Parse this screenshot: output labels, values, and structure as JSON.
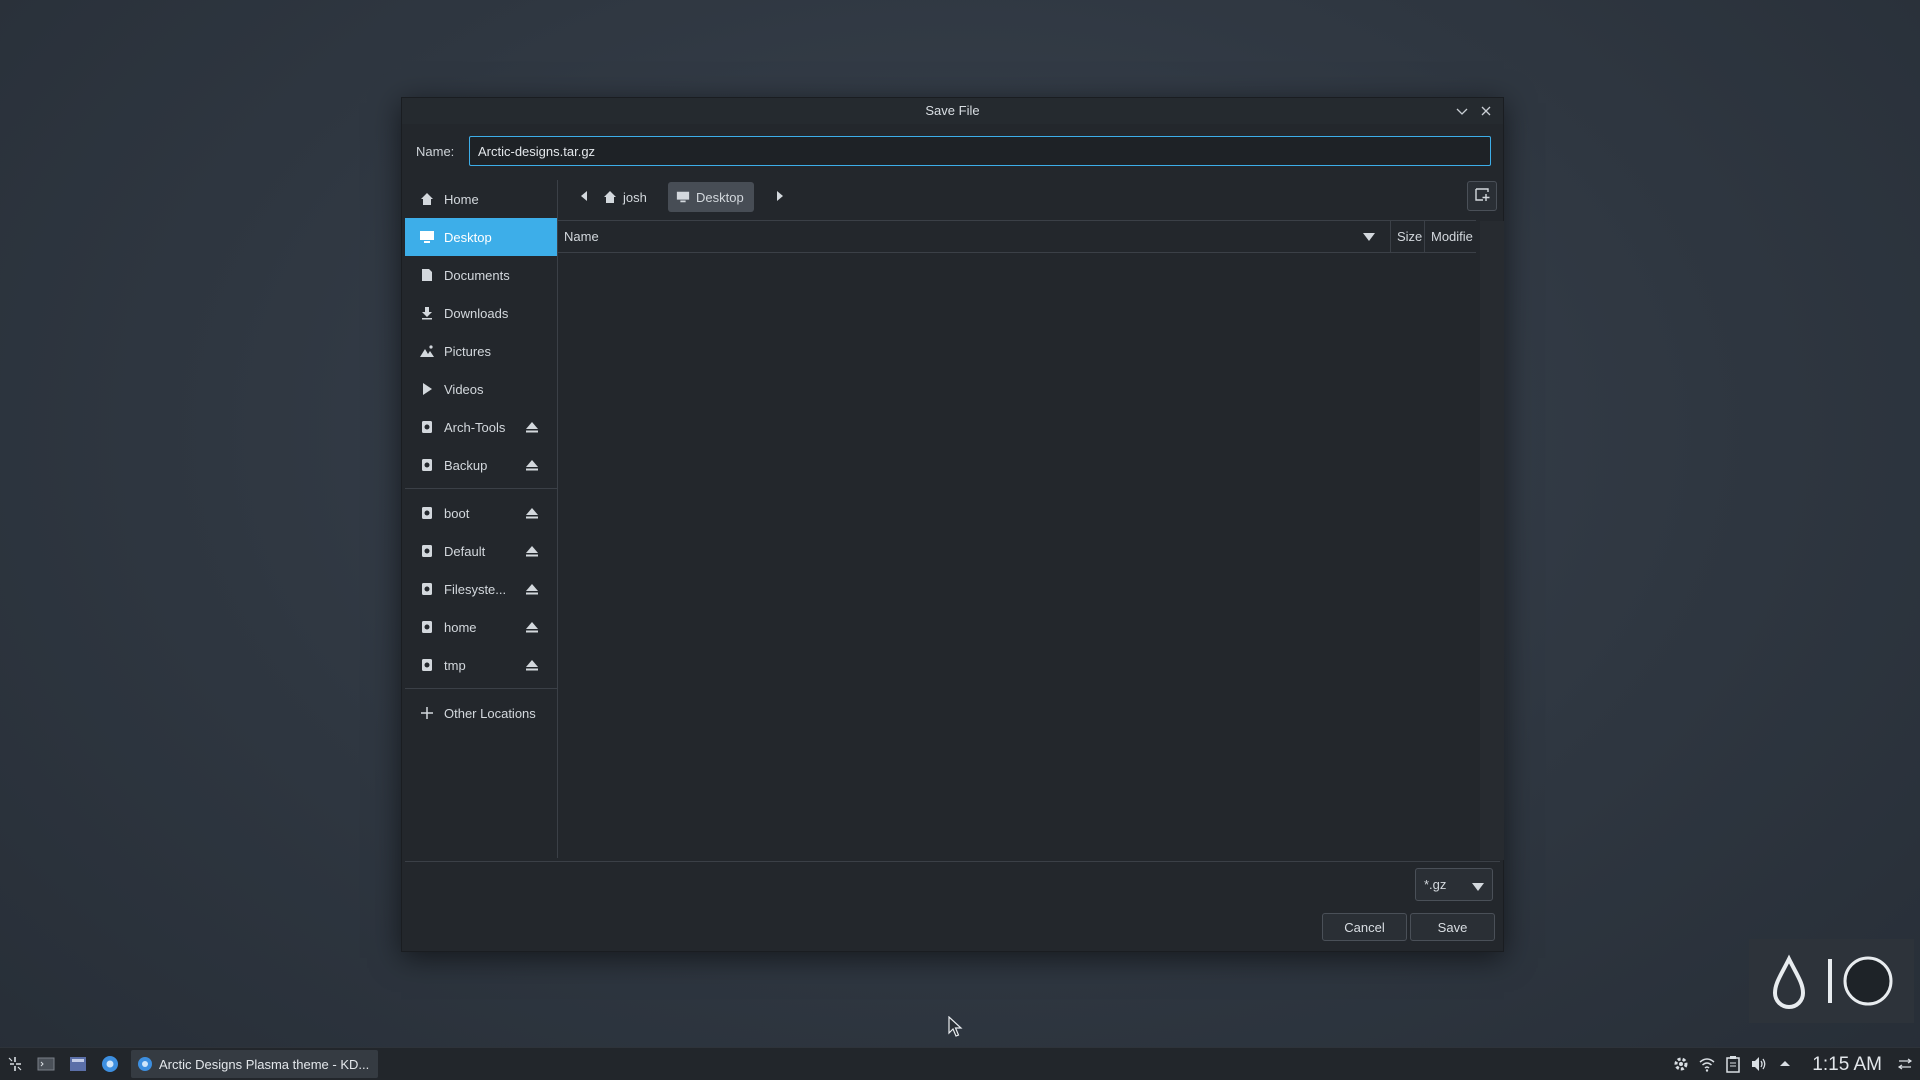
{
  "dialog": {
    "title": "Save File",
    "name_label": "Name:",
    "name_value": "Arctic-designs.tar.gz"
  },
  "sidebar": {
    "items": [
      {
        "label": "Home",
        "icon": "home-icon"
      },
      {
        "label": "Desktop",
        "icon": "desktop-icon",
        "active": true
      },
      {
        "label": "Documents",
        "icon": "document-icon"
      },
      {
        "label": "Downloads",
        "icon": "download-icon"
      },
      {
        "label": "Pictures",
        "icon": "pictures-icon"
      },
      {
        "label": "Videos",
        "icon": "video-icon"
      },
      {
        "label": "Arch-Tools",
        "icon": "drive-icon",
        "eject": true
      },
      {
        "label": "Backup",
        "icon": "drive-icon",
        "eject": true
      }
    ],
    "volumes": [
      {
        "label": "boot",
        "icon": "drive-icon",
        "eject": true
      },
      {
        "label": "Default",
        "icon": "drive-icon",
        "eject": true
      },
      {
        "label": "Filesyste...",
        "icon": "drive-icon",
        "eject": true
      },
      {
        "label": "home",
        "icon": "drive-icon",
        "eject": true
      },
      {
        "label": "tmp",
        "icon": "drive-icon",
        "eject": true
      }
    ],
    "other_locations": "Other Locations"
  },
  "pathbar": {
    "crumbs": [
      {
        "label": "josh",
        "icon": "home-icon"
      },
      {
        "label": "Desktop",
        "icon": "desktop-icon",
        "active": true
      }
    ]
  },
  "filelist": {
    "columns": {
      "name": "Name",
      "size": "Size",
      "modified": "Modifie"
    }
  },
  "filter": {
    "selected": "*.gz"
  },
  "buttons": {
    "cancel": "Cancel",
    "save": "Save"
  },
  "taskbar": {
    "task_title": "Arctic Designs Plasma theme - KD...",
    "clock": "1:15 AM"
  },
  "colors": {
    "accent": "#3daee9",
    "dialog_bg": "#23272c",
    "desktop_bg": "#2f3741"
  }
}
